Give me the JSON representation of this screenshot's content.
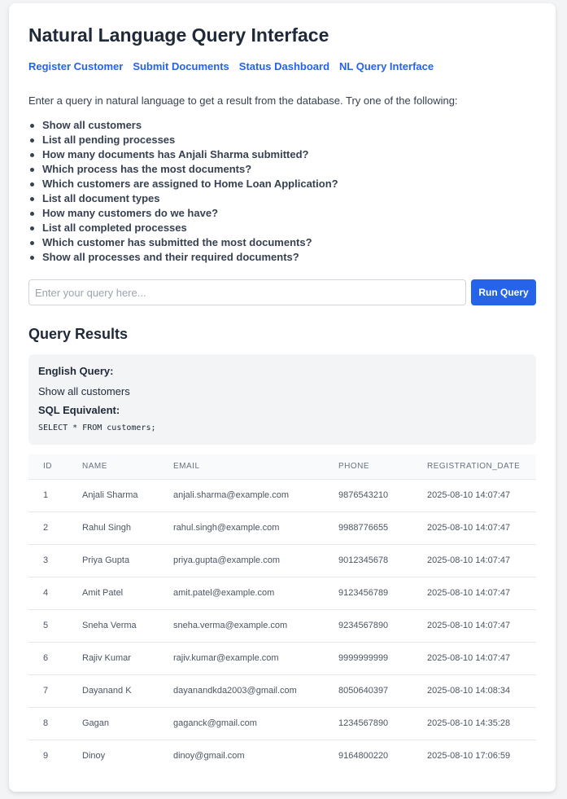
{
  "page": {
    "title": "Natural Language Query Interface"
  },
  "nav": [
    {
      "label": "Register Customer"
    },
    {
      "label": "Submit Documents"
    },
    {
      "label": "Status Dashboard"
    },
    {
      "label": "NL Query Interface"
    }
  ],
  "intro": "Enter a query in natural language to get a result from the database. Try one of the following:",
  "examples": [
    "Show all customers",
    "List all pending processes",
    "How many documents has Anjali Sharma submitted?",
    "Which process has the most documents?",
    "Which customers are assigned to Home Loan Application?",
    "List all document types",
    "How many customers do we have?",
    "List all completed processes",
    "Which customer has submitted the most documents?",
    "Show all processes and their required documents?"
  ],
  "query_input": {
    "placeholder": "Enter your query here...",
    "value": ""
  },
  "run_button": "Run Query",
  "results": {
    "title": "Query Results",
    "english_label": "English Query:",
    "english_query": "Show all customers",
    "sql_label": "SQL Equivalent:",
    "sql": "SELECT * FROM customers;",
    "columns": [
      "ID",
      "NAME",
      "EMAIL",
      "PHONE",
      "REGISTRATION_DATE"
    ],
    "rows": [
      [
        "1",
        "Anjali Sharma",
        "anjali.sharma@example.com",
        "9876543210",
        "2025-08-10 14:07:47"
      ],
      [
        "2",
        "Rahul Singh",
        "rahul.singh@example.com",
        "9988776655",
        "2025-08-10 14:07:47"
      ],
      [
        "3",
        "Priya Gupta",
        "priya.gupta@example.com",
        "9012345678",
        "2025-08-10 14:07:47"
      ],
      [
        "4",
        "Amit Patel",
        "amit.patel@example.com",
        "9123456789",
        "2025-08-10 14:07:47"
      ],
      [
        "5",
        "Sneha Verma",
        "sneha.verma@example.com",
        "9234567890",
        "2025-08-10 14:07:47"
      ],
      [
        "6",
        "Rajiv Kumar",
        "rajiv.kumar@example.com",
        "9999999999",
        "2025-08-10 14:07:47"
      ],
      [
        "7",
        "Dayanand K",
        "dayanandkda2003@gmail.com",
        "8050640397",
        "2025-08-10 14:08:34"
      ],
      [
        "8",
        "Gagan",
        "gaganck@gmail.com",
        "1234567890",
        "2025-08-10 14:35:28"
      ],
      [
        "9",
        "Dinoy",
        "dinoy@gmail.com",
        "9164800220",
        "2025-08-10 17:06:59"
      ]
    ]
  }
}
